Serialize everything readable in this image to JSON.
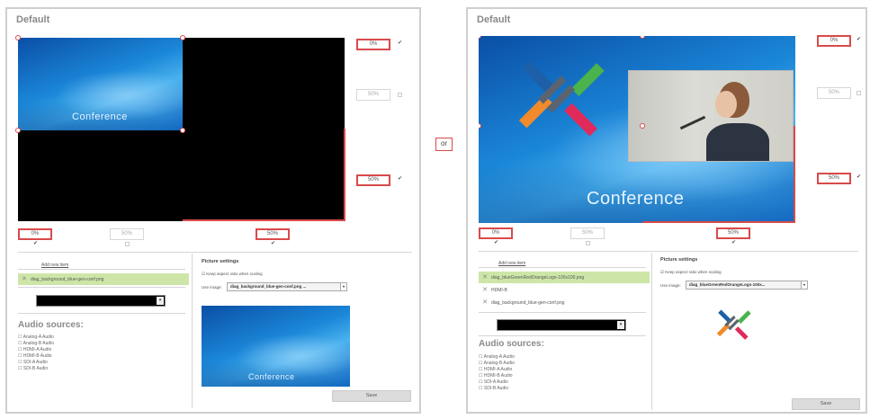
{
  "or_label": "or",
  "left": {
    "title": "Default",
    "canvas_text": "Conference",
    "right_percents": [
      "0%",
      "50%",
      "50%"
    ],
    "bottom_percents": [
      "0%",
      "50%",
      "50%"
    ],
    "add_new_item": "Add new item",
    "sources": [
      {
        "label": "diag_background_blue-gen-conf.png",
        "selected": true
      }
    ],
    "audio_title": "Audio sources:",
    "audio_items": [
      "Analog-A Audio",
      "Analog-B Audio",
      "HDMI-A Audio",
      "HDMI-B Audio",
      "SDI-A Audio",
      "SDI-B Audio"
    ],
    "picture_settings": {
      "title": "Picture settings",
      "keep_aspect": "Keep aspect ratio when scaling",
      "use_image_label": "Use image:",
      "use_image_value": "diag_background_blue-gen-conf.png ...",
      "preview_text": "Conference"
    },
    "save_label": "Save"
  },
  "right": {
    "title": "Default",
    "canvas_text": "Conference",
    "right_percents": [
      "0%",
      "50%",
      "50%"
    ],
    "bottom_percents": [
      "0%",
      "50%",
      "50%"
    ],
    "add_new_item": "Add new item",
    "sources": [
      {
        "label": "diag_blueGreenRedOrangeLogo-100x100.png",
        "selected": true
      },
      {
        "label": "HDMI-B",
        "selected": false
      },
      {
        "label": "diag_background_blue-gen-conf.png",
        "selected": false
      }
    ],
    "audio_title": "Audio sources:",
    "audio_items": [
      "Analog-A Audio",
      "Analog-B Audio",
      "HDMI-A Audio",
      "HDMI-B Audio",
      "SDI-A Audio",
      "SDI-B Audio"
    ],
    "picture_settings": {
      "title": "Picture settings",
      "keep_aspect": "Keep aspect ratio when scaling",
      "use_image_label": "Use image:",
      "use_image_value": "diag_blueGreenRedOrangeLogo-100x...",
      "preview_icon": "epiphan-logo-icon"
    },
    "save_label": "Save"
  },
  "colors": {
    "accent_red": "#d94a4a",
    "selected_row": "#cde6a8",
    "logo_blue": "#1d5fa8",
    "logo_green": "#4bb34b",
    "logo_orange": "#f08a2a",
    "logo_red": "#e02a5a"
  }
}
